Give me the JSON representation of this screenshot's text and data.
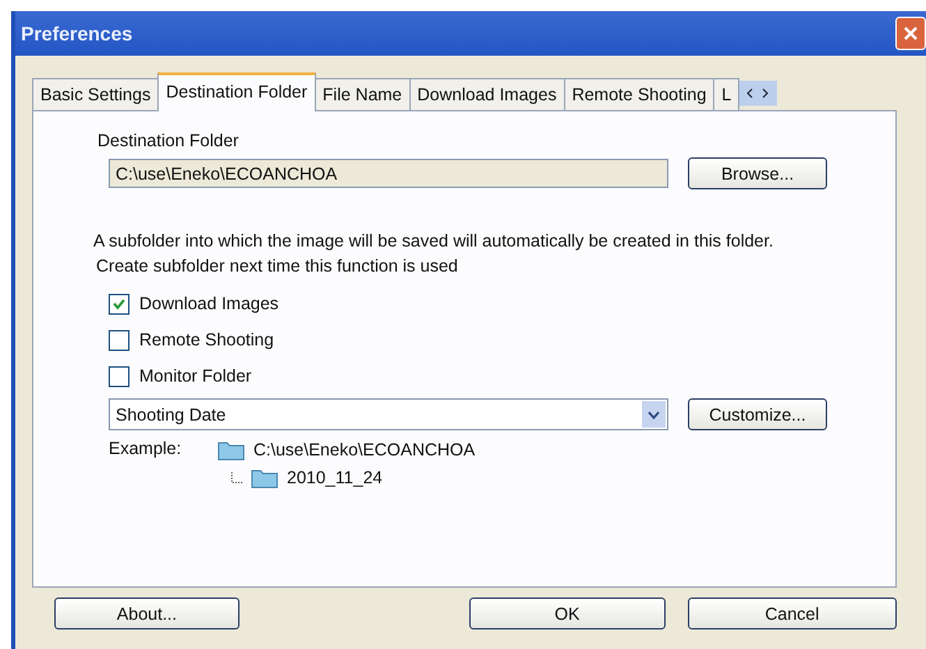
{
  "window": {
    "title": "Preferences"
  },
  "tabs": [
    {
      "label": "Basic Settings",
      "selected": false
    },
    {
      "label": "Destination Folder",
      "selected": true
    },
    {
      "label": "File Name",
      "selected": false
    },
    {
      "label": "Download Images",
      "selected": false
    },
    {
      "label": "Remote Shooting",
      "selected": false
    },
    {
      "label": "L",
      "selected": false
    }
  ],
  "destination": {
    "label": "Destination Folder",
    "value": "C:\\use\\Eneko\\ECOANCHOA",
    "button": "Browse..."
  },
  "description": [
    "A subfolder into which the image will be saved will automatically be created in this folder.",
    "Create subfolder next time this function is used"
  ],
  "options": [
    {
      "label": "Download Images",
      "checked": true
    },
    {
      "label": "Remote Shooting",
      "checked": false
    },
    {
      "label": "Monitor Folder",
      "checked": false
    }
  ],
  "subfolder": {
    "value": "Shooting Date",
    "button": "Customize..."
  },
  "example": {
    "label": "Example:",
    "root": "C:\\use\\Eneko\\ECOANCHOA",
    "children": [
      {
        "name": "2010_11_24"
      }
    ]
  },
  "buttons": [
    "About...",
    "OK",
    "Cancel"
  ]
}
